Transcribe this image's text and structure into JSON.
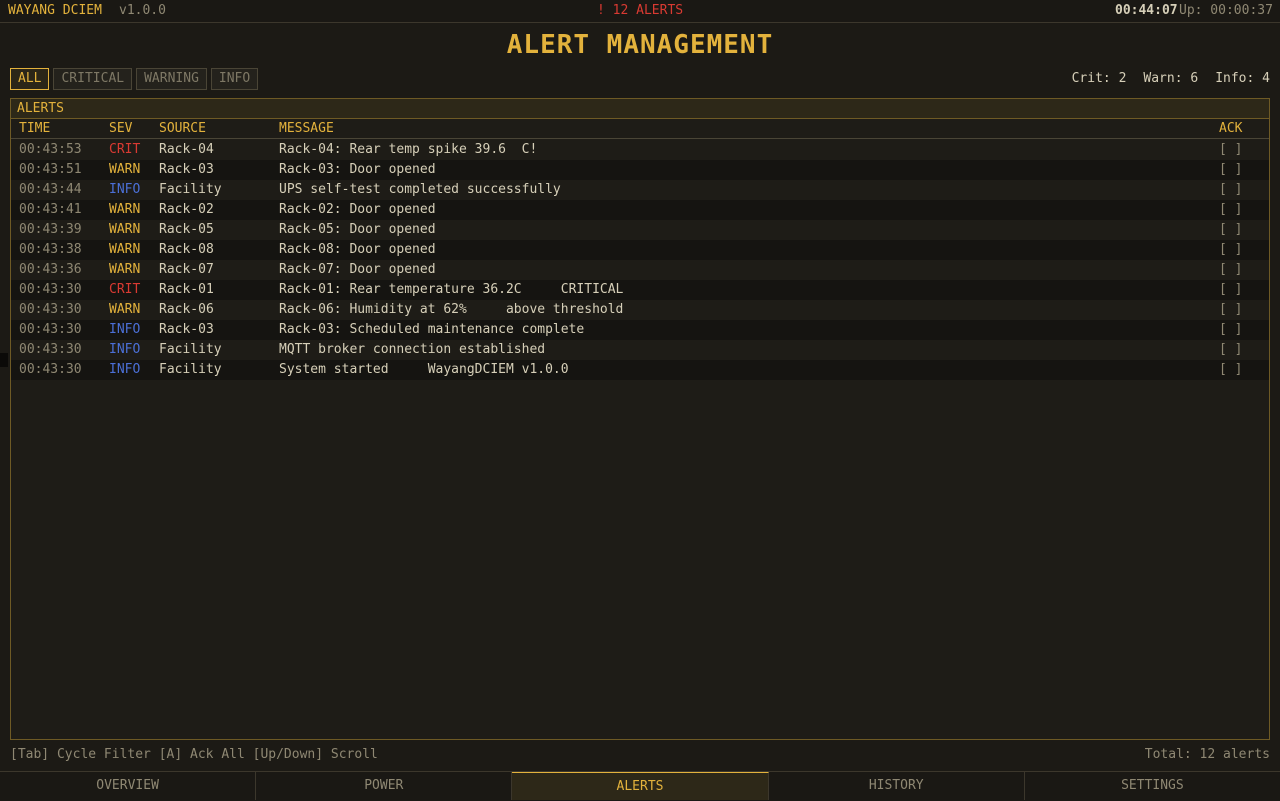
{
  "topbar": {
    "app_name": "WAYANG DCIEM",
    "version": "v1.0.0",
    "alert_count": "! 12 ALERTS",
    "clock": "00:44:07",
    "uptime": "Up: 00:00:37"
  },
  "page": {
    "title": "ALERT MANAGEMENT"
  },
  "filters": [
    {
      "label": "ALL",
      "active": true
    },
    {
      "label": "CRITICAL",
      "active": false
    },
    {
      "label": "WARNING",
      "active": false
    },
    {
      "label": "INFO",
      "active": false
    }
  ],
  "counts": {
    "crit": "Crit: 2",
    "warn": "Warn: 6",
    "info": "Info: 4"
  },
  "panel": {
    "title": "ALERTS",
    "columns": {
      "time": "TIME",
      "sev": "SEV",
      "source": "SOURCE",
      "message": "MESSAGE",
      "ack": "ACK"
    },
    "rows": [
      {
        "time": "00:43:53",
        "sev": "CRIT",
        "source": "Rack-04",
        "message": "Rack-04: Rear temp spike 39.6  C!",
        "ack": "[ ]"
      },
      {
        "time": "00:43:51",
        "sev": "WARN",
        "source": "Rack-03",
        "message": "Rack-03: Door opened",
        "ack": "[ ]"
      },
      {
        "time": "00:43:44",
        "sev": "INFO",
        "source": "Facility",
        "message": "UPS self-test completed successfully",
        "ack": "[ ]"
      },
      {
        "time": "00:43:41",
        "sev": "WARN",
        "source": "Rack-02",
        "message": "Rack-02: Door opened",
        "ack": "[ ]"
      },
      {
        "time": "00:43:39",
        "sev": "WARN",
        "source": "Rack-05",
        "message": "Rack-05: Door opened",
        "ack": "[ ]"
      },
      {
        "time": "00:43:38",
        "sev": "WARN",
        "source": "Rack-08",
        "message": "Rack-08: Door opened",
        "ack": "[ ]"
      },
      {
        "time": "00:43:36",
        "sev": "WARN",
        "source": "Rack-07",
        "message": "Rack-07: Door opened",
        "ack": "[ ]"
      },
      {
        "time": "00:43:30",
        "sev": "CRIT",
        "source": "Rack-01",
        "message": "Rack-01: Rear temperature 36.2C     CRITICAL",
        "ack": "[ ]"
      },
      {
        "time": "00:43:30",
        "sev": "WARN",
        "source": "Rack-06",
        "message": "Rack-06: Humidity at 62%     above threshold",
        "ack": "[ ]"
      },
      {
        "time": "00:43:30",
        "sev": "INFO",
        "source": "Rack-03",
        "message": "Rack-03: Scheduled maintenance complete",
        "ack": "[ ]"
      },
      {
        "time": "00:43:30",
        "sev": "INFO",
        "source": "Facility",
        "message": "MQTT broker connection established",
        "ack": "[ ]"
      },
      {
        "time": "00:43:30",
        "sev": "INFO",
        "source": "Facility",
        "message": "System started     WayangDCIEM v1.0.0",
        "ack": "[ ]"
      }
    ]
  },
  "footer": {
    "help": "[Tab] Cycle Filter  [A] Ack All  [Up/Down] Scroll",
    "total": "Total: 12 alerts"
  },
  "tabs": [
    {
      "label": "OVERVIEW",
      "active": false
    },
    {
      "label": "POWER",
      "active": false
    },
    {
      "label": "ALERTS",
      "active": true
    },
    {
      "label": "HISTORY",
      "active": false
    },
    {
      "label": "SETTINGS",
      "active": false
    }
  ],
  "colors": {
    "accent": "#e3b23c",
    "critical": "#d93a32",
    "info": "#4b6fd6",
    "background": "#1c1a15"
  }
}
